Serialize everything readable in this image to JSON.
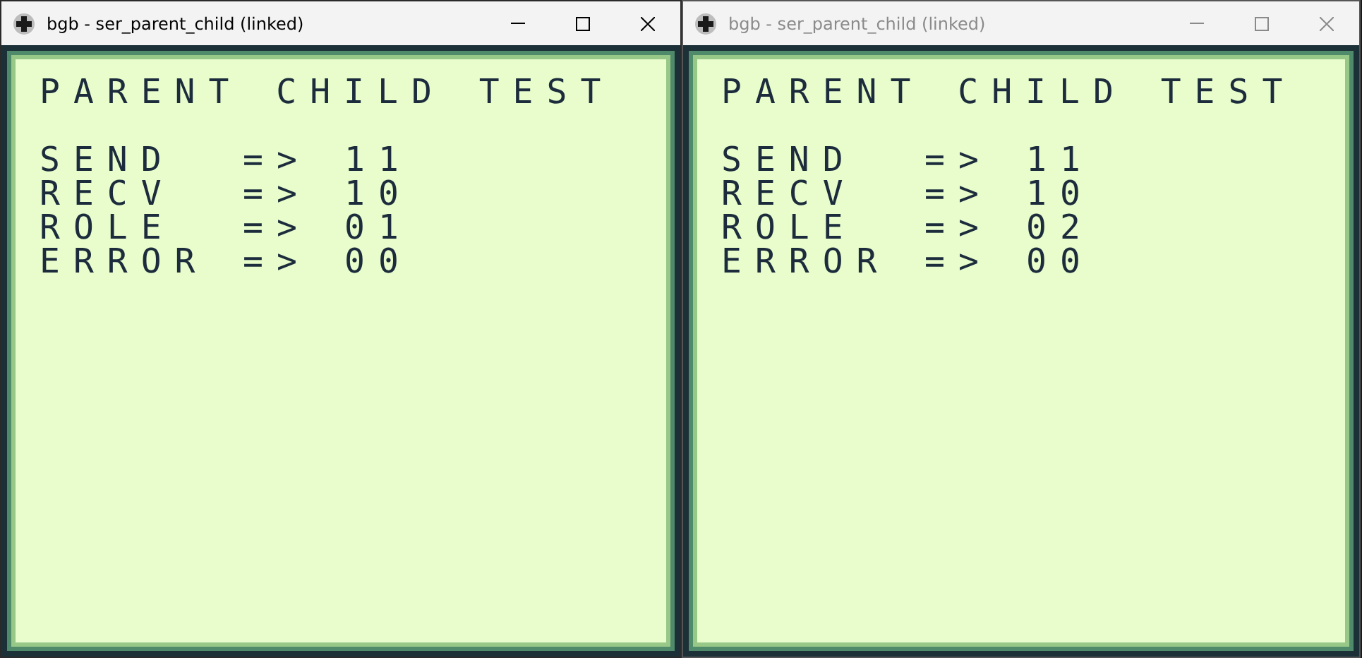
{
  "windows": [
    {
      "title": "bgb - ser_parent_child (linked)",
      "active": true,
      "screen": {
        "heading": "PARENT CHILD TEST",
        "rows": [
          {
            "label": "SEND",
            "arrow": "=>",
            "value": "11"
          },
          {
            "label": "RECV",
            "arrow": "=>",
            "value": "10"
          },
          {
            "label": "ROLE",
            "arrow": "=>",
            "value": "01"
          },
          {
            "label": "ERROR",
            "arrow": "=>",
            "value": "00"
          }
        ]
      }
    },
    {
      "title": "bgb - ser_parent_child (linked)",
      "active": false,
      "screen": {
        "heading": "PARENT CHILD TEST",
        "rows": [
          {
            "label": "SEND",
            "arrow": "=>",
            "value": "11"
          },
          {
            "label": "RECV",
            "arrow": "=>",
            "value": "10"
          },
          {
            "label": "ROLE",
            "arrow": "=>",
            "value": "02"
          },
          {
            "label": "ERROR",
            "arrow": "=>",
            "value": "00"
          }
        ]
      }
    }
  ]
}
